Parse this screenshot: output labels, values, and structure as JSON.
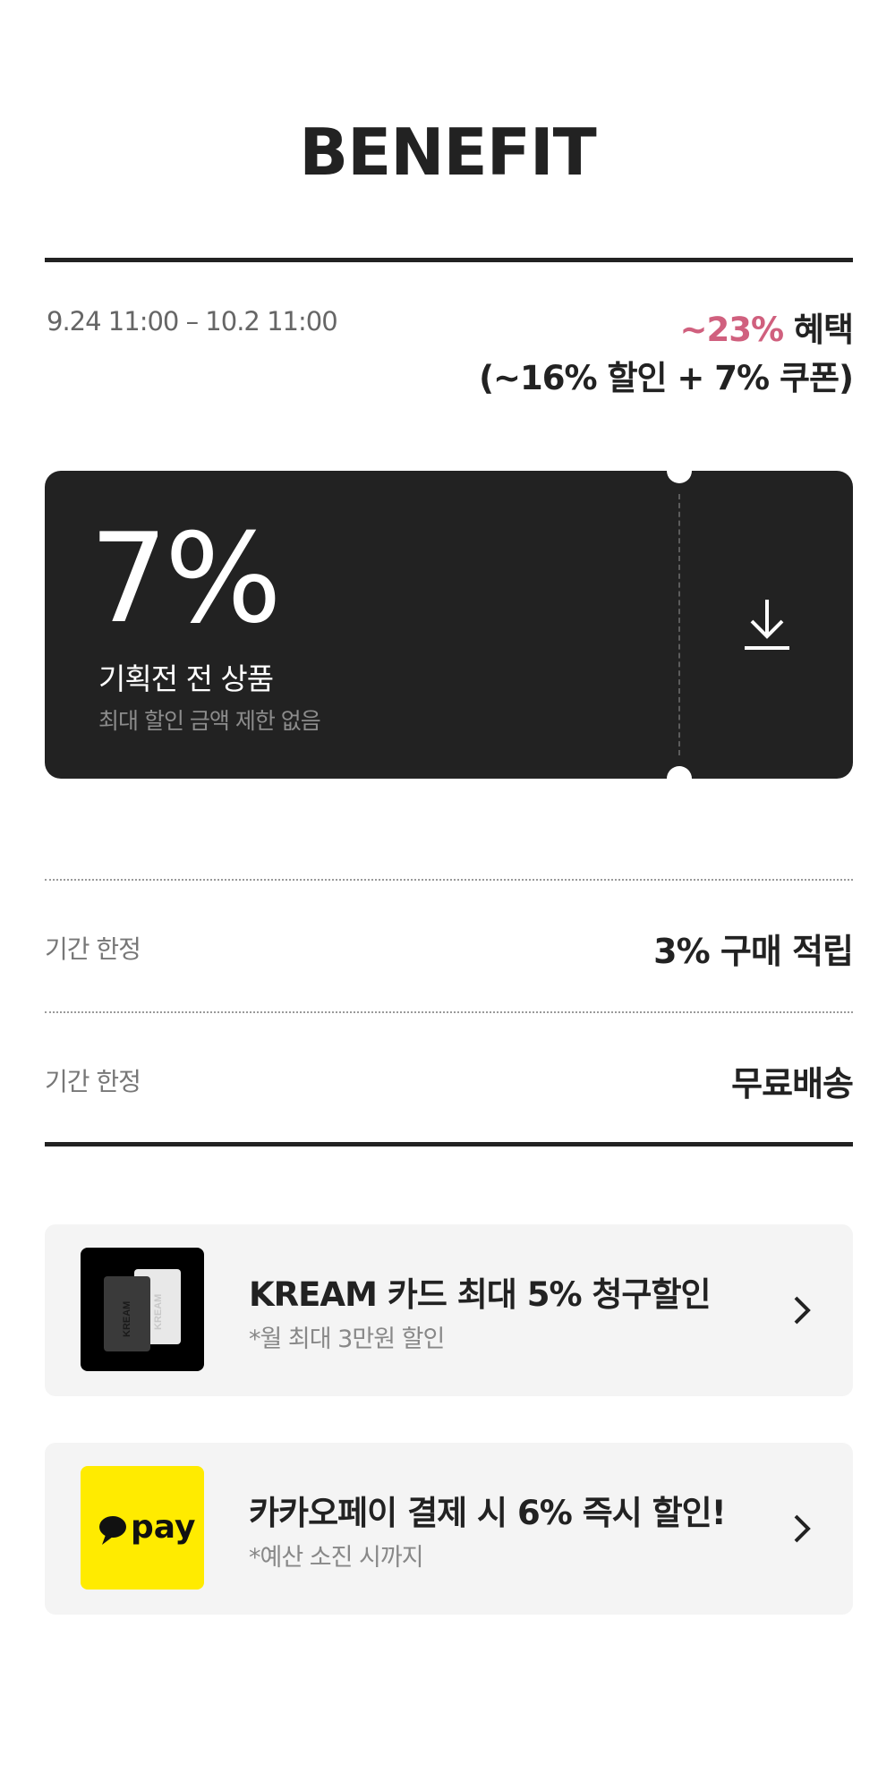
{
  "header": {
    "title": "BENEFIT"
  },
  "event": {
    "period": "9.24 11:00 – 10.2 11:00",
    "total_highlight": "~23%",
    "total_suffix": " 혜택",
    "breakdown": "(~16% 할인 + 7% 쿠폰)"
  },
  "coupon": {
    "percent": "7%",
    "label": "기획전 전 상품",
    "sub": "최대 할인 금액 제한 없음",
    "download_icon": "download-icon"
  },
  "benefits": [
    {
      "tag": "기간 한정",
      "value": "3% 구매 적립"
    },
    {
      "tag": "기간 한정",
      "value": "무료배송"
    }
  ],
  "promos": [
    {
      "title": "KREAM 카드 최대 5% 청구할인",
      "sub": "*월 최대 3만원 할인",
      "icon": "kream-card-icon",
      "card_text": "KREAM"
    },
    {
      "title": "카카오페이 결제 시 6% 즉시 할인!",
      "sub": "*예산 소진 시까지",
      "icon": "kakaopay-icon",
      "logo_text": "pay",
      "logo_bg": "#ffeb00"
    }
  ],
  "colors": {
    "accent": "#d0607e",
    "dark": "#222222",
    "card_bg": "#f4f4f4"
  }
}
